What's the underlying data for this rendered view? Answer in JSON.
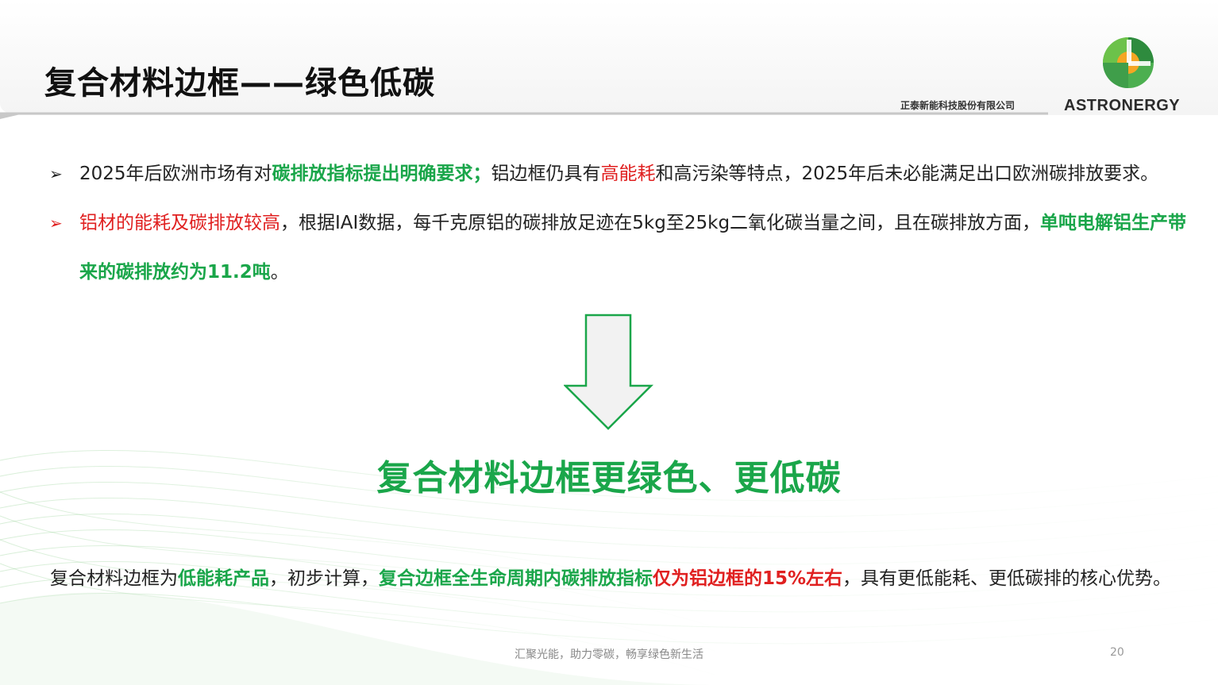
{
  "header": {
    "title": "复合材料边框——绿色低碳",
    "company_name": "正泰新能科技股份有限公司",
    "brand": "ASTRONERGY"
  },
  "bullets": [
    {
      "marker": "➢",
      "parts": [
        "2025年后欧洲市场有对",
        "碳排放指标提出明确要求；",
        "铝边框仍具有",
        "高能耗",
        "和高污染等特点，2025年后未必能满足出口欧洲碳排放要求。"
      ]
    },
    {
      "marker": "➢",
      "parts": [
        "铝材的能耗及碳排放较高",
        "，根据IAI数据，每千克原铝的碳排放足迹在5kg至25kg二氧化碳当量之间，且在碳排放方面，",
        "单吨电解铝生产带来的碳排放约为11.2吨",
        "。"
      ]
    }
  ],
  "headline": "复合材料边框更绿色、更低碳",
  "summary": {
    "parts": [
      "复合材料边框为",
      "低能耗产品",
      "，初步计算，",
      "复合边框全生命周期内碳排放指标",
      "仅为铝边框的15%左右",
      "，具有更低能耗、更低碳排的核心优势。"
    ]
  },
  "footer": {
    "slogan": "汇聚光能，助力零碳，畅享绿色新生活",
    "page_number": "20"
  },
  "colors": {
    "accent_green": "#1aa64a",
    "highlight_red": "#e02020",
    "logo_green": "#4caf50",
    "logo_orange": "#f5a623"
  },
  "icons": {
    "bullet": "arrow-bullet-icon",
    "down_arrow": "down-arrow-icon",
    "logo": "astronergy-logo"
  }
}
